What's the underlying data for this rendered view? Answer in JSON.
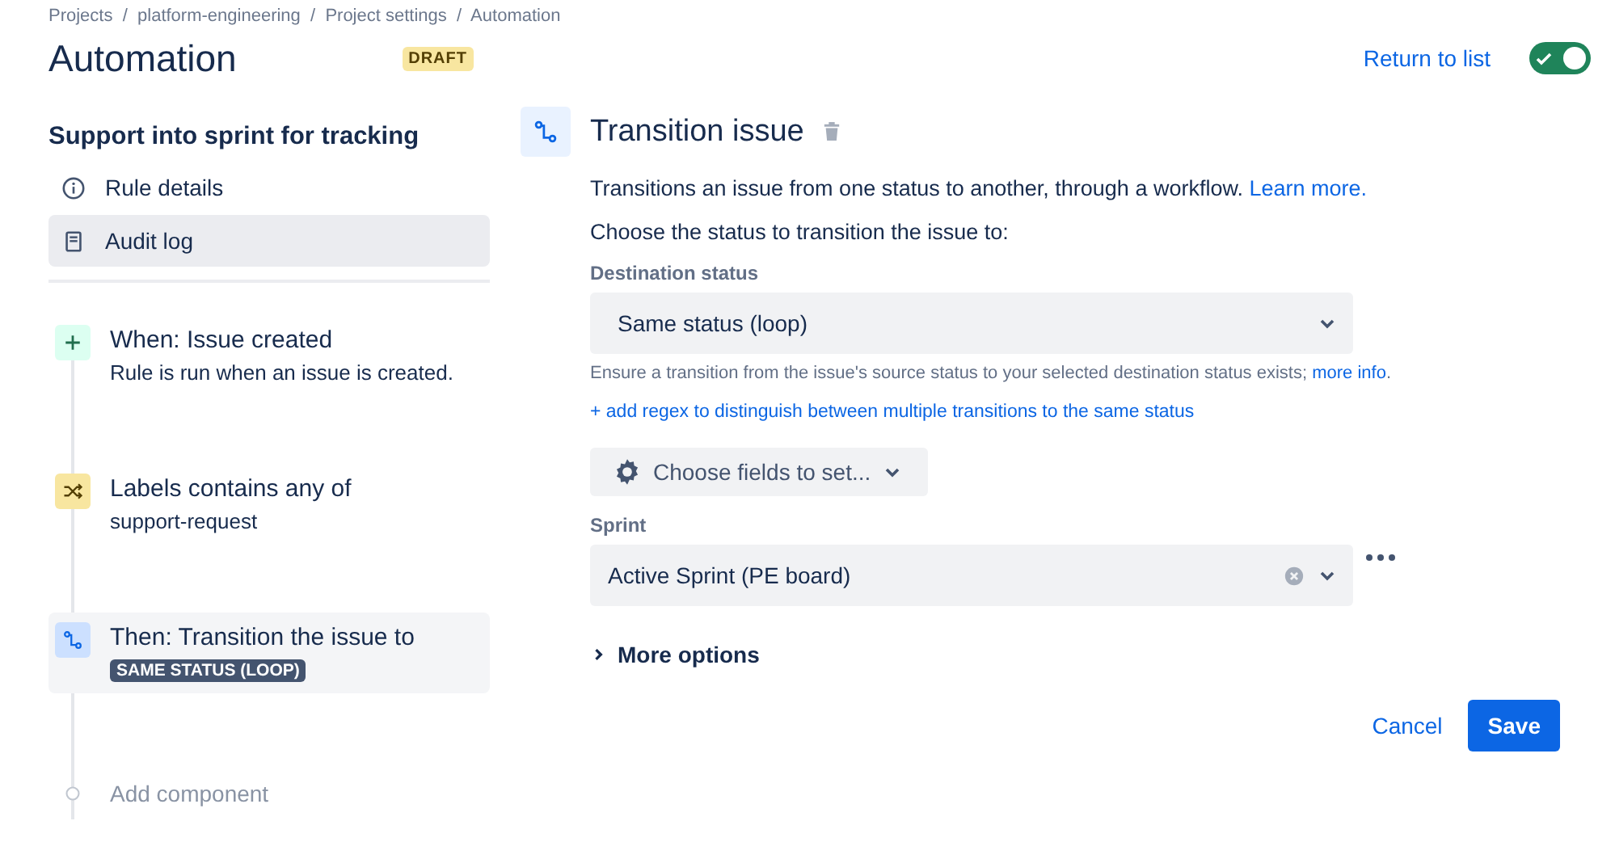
{
  "breadcrumbs": "Projects  /  platform-engineering  /  Project settings  /  Automation",
  "header": {
    "title": "Automation",
    "badge": "DRAFT",
    "return_link": "Return to list",
    "toggle": {
      "on": true
    }
  },
  "sidebar": {
    "rule_name": "Support into sprint for tracking",
    "items": [
      {
        "label": "Rule details",
        "selected": false
      },
      {
        "label": "Audit log",
        "selected": true
      }
    ],
    "steps": [
      {
        "kind": "trigger",
        "title": "When: Issue created",
        "detail": "Rule is run when an issue is created.",
        "selected": false
      },
      {
        "kind": "condition",
        "title": "Labels contains any of",
        "detail": "support-request",
        "selected": false
      },
      {
        "kind": "action",
        "title": "Then: Transition the issue to",
        "lozenge": "SAME STATUS (LOOP)",
        "selected": true
      },
      {
        "kind": "add",
        "title": "Add component",
        "selected": false
      }
    ]
  },
  "panel": {
    "title": "Transition issue",
    "description": "Transitions an issue from one status to another, through a workflow.",
    "learn_more": "Learn more.",
    "prompt": "Choose the status to transition the issue to:",
    "destination": {
      "label": "Destination status",
      "value": "Same status (loop)"
    },
    "helper": "Ensure a transition from the issue's source status to your selected destination status exists;",
    "helper_link": "more info",
    "helper_end": ".",
    "regex_link": "+ add regex to distinguish between multiple transitions to the same status",
    "fields_button": "Choose fields to set...",
    "sprint": {
      "label": "Sprint",
      "value": "Active Sprint (PE board)"
    },
    "more_options": "More options",
    "more_options_expanded": false,
    "buttons": {
      "cancel": "Cancel",
      "save": "Save"
    }
  }
}
